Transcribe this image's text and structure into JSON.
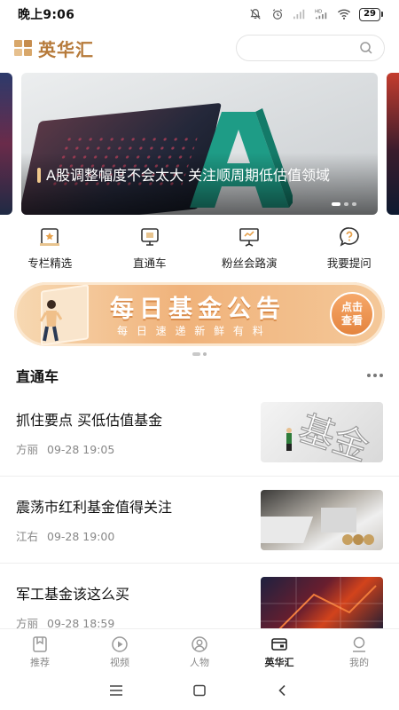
{
  "status": {
    "time": "晚上9:06",
    "battery": "29",
    "net_label": "HD"
  },
  "header": {
    "title": "英华汇",
    "search_placeholder": ""
  },
  "banner": {
    "caption": "A股调整幅度不会太大 关注顺周期低估值领域",
    "letter": "A",
    "slide_index": 1,
    "slide_count": 3
  },
  "quick_menu": [
    {
      "label": "专栏精选",
      "icon": "column-star-icon"
    },
    {
      "label": "直通车",
      "icon": "monitor-icon"
    },
    {
      "label": "粉丝会路演",
      "icon": "presentation-board-icon"
    },
    {
      "label": "我要提问",
      "icon": "question-bubble-icon"
    }
  ],
  "promo": {
    "title": "每日基金公告",
    "subtitle": "每 日 速 递   新 鲜 有 料",
    "button_line1": "点击",
    "button_line2": "查看"
  },
  "section": {
    "title": "直通车"
  },
  "articles": [
    {
      "title": "抓住要点 买低估值基金",
      "author": "方丽",
      "time": "09-28 19:05",
      "thumb_text": "基金"
    },
    {
      "title": "震荡市红利基金值得关注",
      "author": "江右",
      "time": "09-28 19:00",
      "thumb_text": ""
    },
    {
      "title": "军工基金该这么买",
      "author": "方丽",
      "time": "09-28 18:59",
      "thumb_text": ""
    }
  ],
  "tabs": [
    {
      "label": "推荐",
      "icon": "bookmark-icon",
      "active": false
    },
    {
      "label": "视频",
      "icon": "play-icon",
      "active": false
    },
    {
      "label": "人物",
      "icon": "person-icon",
      "active": false
    },
    {
      "label": "英华汇",
      "icon": "wallet-card-icon",
      "active": true
    },
    {
      "label": "我的",
      "icon": "profile-icon",
      "active": false
    }
  ],
  "colors": {
    "brand": "#b67a3a",
    "promo": "#f0b27a",
    "accent_bar": "#f0c88c"
  }
}
